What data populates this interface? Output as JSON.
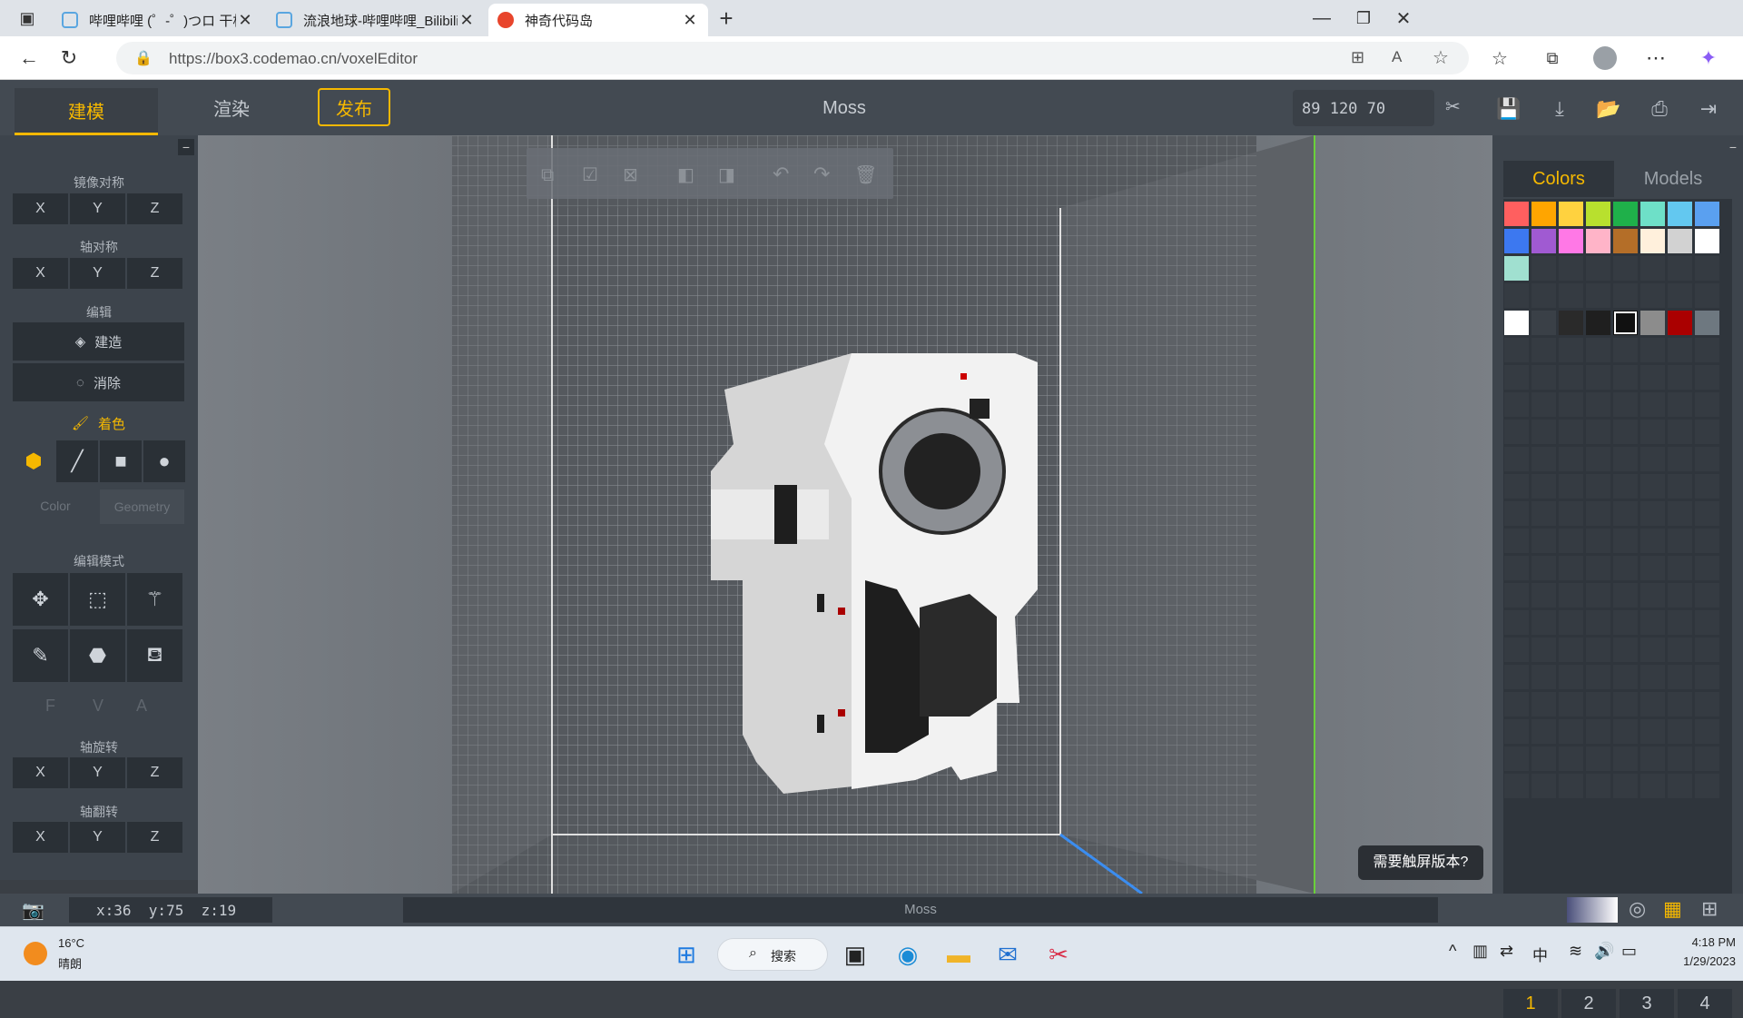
{
  "browser": {
    "tabs": [
      {
        "label": "哔哩哔哩 (゜-゜)つロ 干杯~-bilibili",
        "icon": "bilibili-icon",
        "active": false
      },
      {
        "label": "流浪地球-哔哩哔哩_Bilibili",
        "icon": "bilibili-icon",
        "active": false
      },
      {
        "label": "神奇代码岛",
        "icon": "codemao-icon",
        "active": true
      }
    ],
    "new_tab": "+",
    "url": "https://box3.codemao.cn/voxelEditor",
    "window_controls": [
      "minimize",
      "restore",
      "close"
    ]
  },
  "app": {
    "tabs": {
      "model": "建模",
      "render": "渲染",
      "publish": "发布"
    },
    "model_name": "Moss",
    "dimensions": "89 120 70",
    "accent": "#f5b800"
  },
  "left_panel": {
    "mirror_label": "镜像对称",
    "mirror_axes": [
      "X",
      "Y",
      "Z"
    ],
    "axis_sym_label": "轴对称",
    "axis_sym_axes": [
      "X",
      "Y",
      "Z"
    ],
    "edit_label": "编辑",
    "build": "建造",
    "erase": "消除",
    "paint": "着色",
    "color_tab": "Color",
    "geometry_tab": "Geometry",
    "edit_mode_label": "编辑模式",
    "fva": [
      "F",
      "V",
      "A"
    ],
    "rotate_label": "轴旋转",
    "rotate_axes": [
      "X",
      "Y",
      "Z"
    ],
    "flip_label": "轴翻转",
    "flip_axes": [
      "X",
      "Y",
      "Z"
    ]
  },
  "right_panel": {
    "tabs": [
      "Colors",
      "Models"
    ],
    "palette": [
      "#ff5f5f",
      "#ffa500",
      "#ffd23f",
      "#b8e02e",
      "#1fb04a",
      "#6ee0c8",
      "#63c8f0",
      "#5aa0f0",
      "#3c78f0",
      "#a05ad2",
      "#ff78e6",
      "#ffb4c8",
      "#b46e28",
      "#fff0dc",
      "#d2d2d2",
      "#ffffff",
      "#a0e0d0"
    ],
    "recent": [
      "#ffffff",
      "#3a4047",
      "#2a2a2a",
      "#1f1f1f",
      "#111111",
      "#8c8c8c",
      "#aa0000",
      "#6e7880"
    ],
    "selected_recent": 4,
    "pages": [
      "1",
      "2",
      "3",
      "4"
    ],
    "active_page": 0
  },
  "viewport": {
    "touch_prompt": "需要触屏版本?"
  },
  "status": {
    "coords": "x:36  y:75  z:19",
    "name": "Moss"
  },
  "taskbar": {
    "weather_temp": "16°C",
    "weather_desc": "晴朗",
    "search": "搜索",
    "ime": "中",
    "time": "4:18 PM",
    "date": "1/29/2023"
  }
}
